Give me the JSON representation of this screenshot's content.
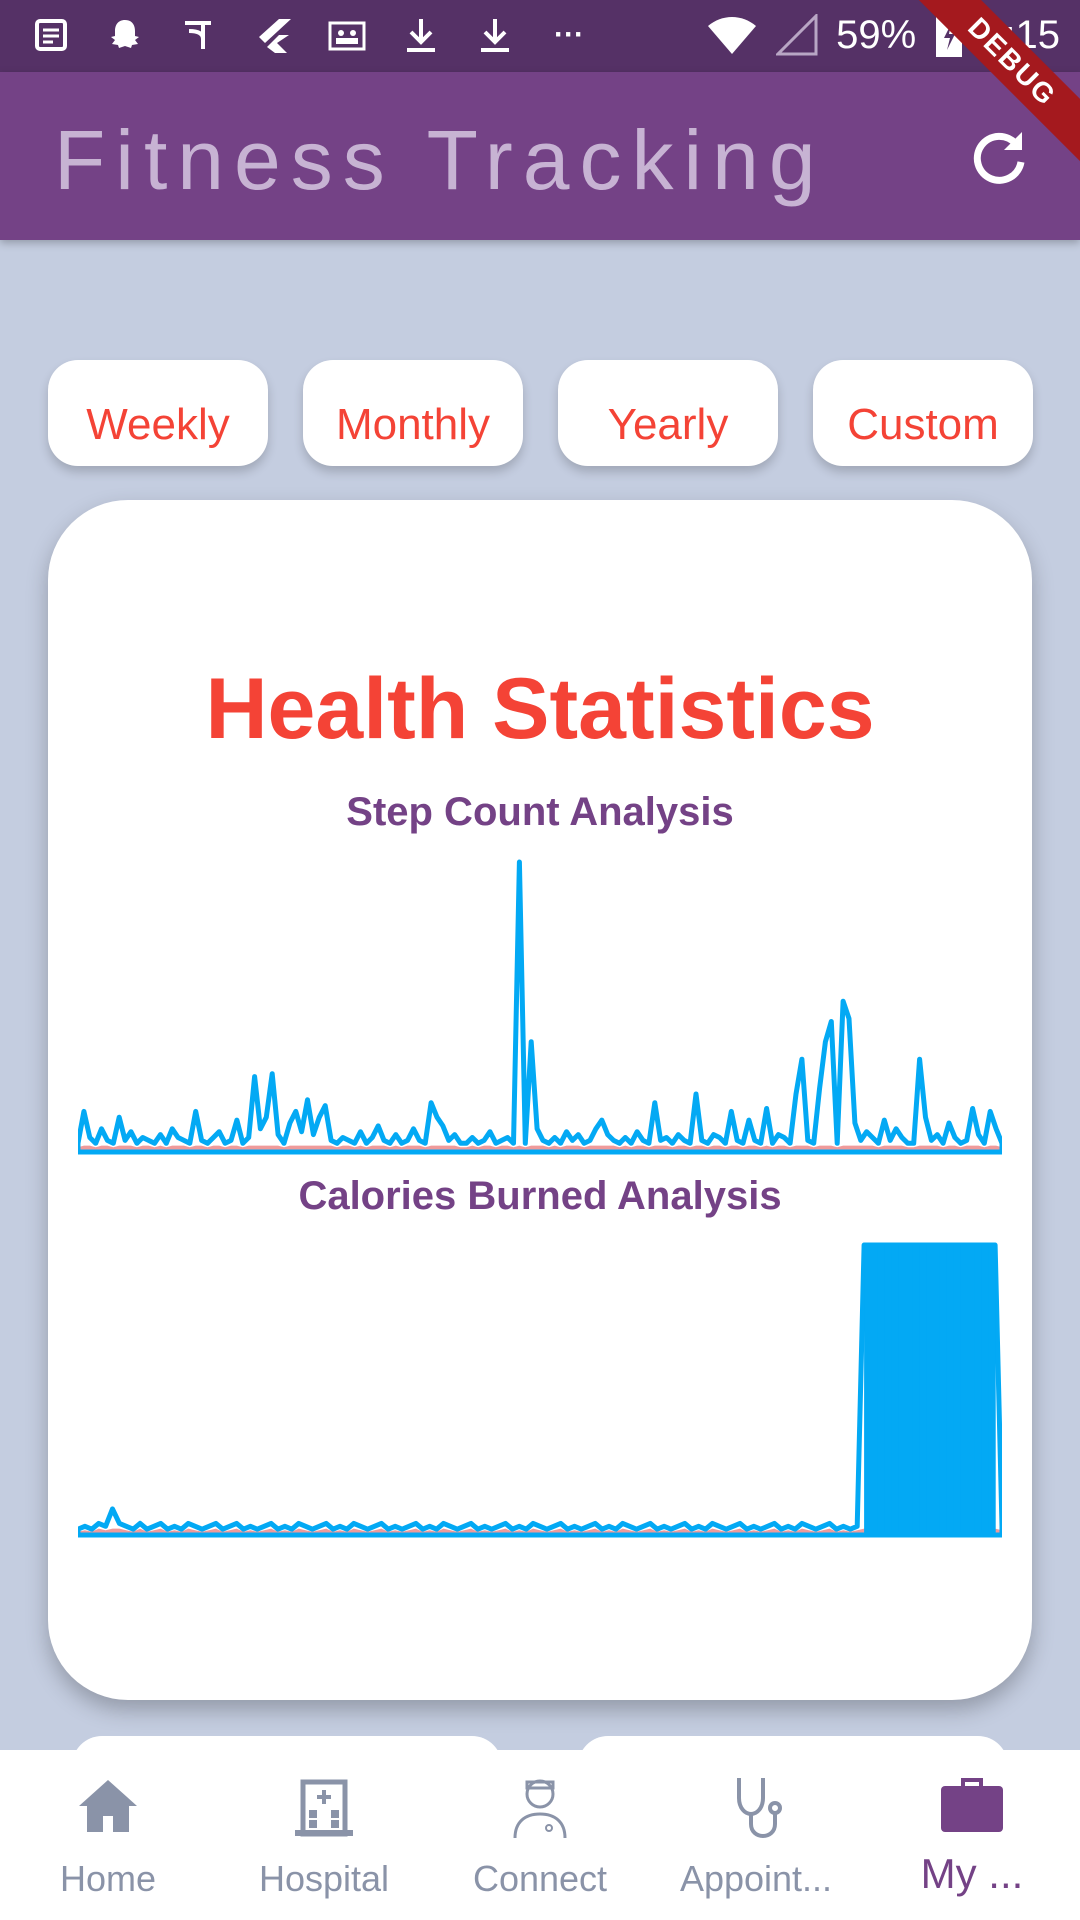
{
  "status_bar": {
    "battery": "59%",
    "time": "4:15",
    "more": "···",
    "icons": [
      "news-icon",
      "snapchat-icon",
      "phonepe-icon",
      "flutter-icon",
      "teams-icon",
      "download-icon",
      "download-icon"
    ]
  },
  "debug_banner": "DEBUG",
  "app_bar": {
    "title": "Fitness Tracking",
    "action_icon": "refresh-icon"
  },
  "filter_tabs": [
    {
      "label": "Weekly"
    },
    {
      "label": "Monthly"
    },
    {
      "label": "Yearly"
    },
    {
      "label": "Custom"
    }
  ],
  "card": {
    "title": "Health Statistics"
  },
  "chart_data": [
    {
      "type": "area",
      "title": "Step Count Analysis",
      "series_colors": [
        "#03a9f4",
        "#ef9a9a"
      ],
      "ylim": [
        0,
        100
      ],
      "grid": false,
      "legend": "none",
      "values": [
        3,
        14,
        5,
        3,
        8,
        4,
        3,
        12,
        4,
        7,
        3,
        5,
        4,
        3,
        6,
        3,
        8,
        5,
        4,
        3,
        14,
        4,
        3,
        5,
        7,
        3,
        4,
        11,
        3,
        5,
        26,
        8,
        12,
        27,
        6,
        3,
        10,
        14,
        7,
        18,
        6,
        12,
        16,
        4,
        3,
        5,
        4,
        3,
        7,
        3,
        5,
        9,
        4,
        3,
        6,
        3,
        4,
        8,
        4,
        3,
        17,
        12,
        9,
        4,
        6,
        3,
        3,
        5,
        3,
        4,
        7,
        3,
        4,
        5,
        3,
        100,
        3,
        38,
        8,
        4,
        3,
        5,
        3,
        7,
        4,
        6,
        3,
        4,
        8,
        11,
        6,
        4,
        3,
        5,
        3,
        7,
        4,
        3,
        17,
        4,
        5,
        3,
        6,
        4,
        3,
        20,
        4,
        3,
        6,
        5,
        3,
        14,
        4,
        3,
        11,
        4,
        3,
        15,
        3,
        6,
        5,
        3,
        20,
        32,
        4,
        3,
        22,
        38,
        45,
        3,
        52,
        46,
        10,
        4,
        7,
        5,
        3,
        11,
        4,
        8,
        5,
        3,
        3,
        32,
        12,
        4,
        6,
        3,
        10,
        5,
        3,
        4,
        15,
        6,
        3,
        14,
        8,
        3
      ]
    },
    {
      "type": "area",
      "title": "Calories Burned Analysis",
      "series_colors": [
        "#03a9f4",
        "#ef9a9a"
      ],
      "ylim": [
        0,
        100
      ],
      "grid": false,
      "legend": "none",
      "values": [
        2,
        3,
        2,
        4,
        3,
        9,
        4,
        3,
        2,
        4,
        2,
        3,
        4,
        2,
        3,
        2,
        4,
        3,
        2,
        3,
        4,
        2,
        3,
        4,
        2,
        3,
        2,
        3,
        4,
        2,
        3,
        2,
        4,
        3,
        2,
        3,
        4,
        2,
        3,
        2,
        4,
        3,
        2,
        3,
        4,
        2,
        3,
        2,
        3,
        4,
        2,
        3,
        2,
        4,
        3,
        2,
        3,
        4,
        2,
        3,
        2,
        3,
        4,
        2,
        3,
        2,
        4,
        3,
        2,
        3,
        4,
        2,
        3,
        2,
        3,
        4,
        2,
        3,
        2,
        4,
        3,
        2,
        3,
        4,
        2,
        3,
        2,
        3,
        4,
        2,
        3,
        2,
        4,
        3,
        2,
        3,
        4,
        2,
        3,
        2,
        3,
        4,
        2,
        3,
        2,
        4,
        3,
        2,
        3,
        4,
        2,
        3,
        2,
        3,
        100,
        100,
        100,
        100,
        100,
        100,
        100,
        100,
        100,
        100,
        100,
        100,
        100,
        100,
        100,
        100,
        100,
        100,
        100,
        100,
        3
      ]
    }
  ],
  "bottom_nav": [
    {
      "label": "Home",
      "icon": "home-icon",
      "active": false
    },
    {
      "label": "Hospital",
      "icon": "hospital-icon",
      "active": false
    },
    {
      "label": "Connect",
      "icon": "doctor-icon",
      "active": false
    },
    {
      "label": "Appoint...",
      "icon": "stethoscope-icon",
      "active": false
    },
    {
      "label": "My ...",
      "icon": "briefcase-icon",
      "active": true
    }
  ],
  "colors": {
    "status_bar": "#553166",
    "app_bar": "#744286",
    "background": "#c4cde0",
    "accent_red": "#f44336",
    "purple": "#744286",
    "series_blue": "#03a9f4",
    "series_pink": "#ef9a9a",
    "nav_inactive": "#8a93a8"
  }
}
